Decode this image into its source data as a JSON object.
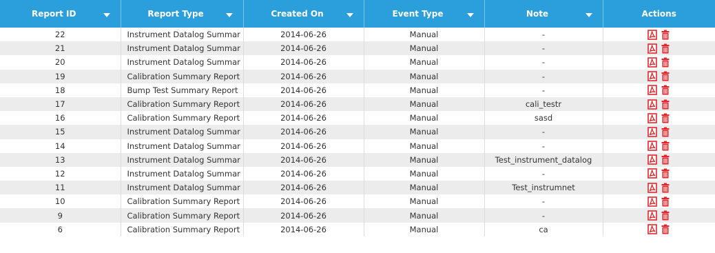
{
  "columns": {
    "report_id": "Report ID",
    "report_type": "Report Type",
    "created_on": "Created On",
    "event_type": "Event Type",
    "note": "Note",
    "actions": "Actions"
  },
  "rows": [
    {
      "id": "22",
      "type": "Instrument Datalog Summar",
      "created": "2014-06-26",
      "event": "Manual",
      "note": "-"
    },
    {
      "id": "21",
      "type": "Instrument Datalog Summar",
      "created": "2014-06-26",
      "event": "Manual",
      "note": "-"
    },
    {
      "id": "20",
      "type": "Instrument Datalog Summar",
      "created": "2014-06-26",
      "event": "Manual",
      "note": "-"
    },
    {
      "id": "19",
      "type": "Calibration Summary Report",
      "created": "2014-06-26",
      "event": "Manual",
      "note": "-"
    },
    {
      "id": "18",
      "type": "Bump Test Summary Report",
      "created": "2014-06-26",
      "event": "Manual",
      "note": "-"
    },
    {
      "id": "17",
      "type": "Calibration Summary Report",
      "created": "2014-06-26",
      "event": "Manual",
      "note": "cali_testr"
    },
    {
      "id": "16",
      "type": "Calibration Summary Report",
      "created": "2014-06-26",
      "event": "Manual",
      "note": "sasd"
    },
    {
      "id": "15",
      "type": "Instrument Datalog Summar",
      "created": "2014-06-26",
      "event": "Manual",
      "note": "-"
    },
    {
      "id": "14",
      "type": "Instrument Datalog Summar",
      "created": "2014-06-26",
      "event": "Manual",
      "note": "-"
    },
    {
      "id": "13",
      "type": "Instrument Datalog Summar",
      "created": "2014-06-26",
      "event": "Manual",
      "note": "Test_instrument_datalog"
    },
    {
      "id": "12",
      "type": "Instrument Datalog Summar",
      "created": "2014-06-26",
      "event": "Manual",
      "note": "-"
    },
    {
      "id": "11",
      "type": "Instrument Datalog Summar",
      "created": "2014-06-26",
      "event": "Manual",
      "note": "Test_instrumnet"
    },
    {
      "id": "10",
      "type": "Calibration Summary Report",
      "created": "2014-06-26",
      "event": "Manual",
      "note": "-"
    },
    {
      "id": "9",
      "type": "Calibration Summary Report",
      "created": "2014-06-26",
      "event": "Manual",
      "note": "-"
    },
    {
      "id": "6",
      "type": "Calibration Summary Report",
      "created": "2014-06-26",
      "event": "Manual",
      "note": "ca"
    }
  ],
  "icons": {
    "pdf": "pdf-icon",
    "delete": "trash-icon"
  },
  "colors": {
    "header_bg": "#2b9fdc",
    "header_text": "#ffffff",
    "row_alt": "#ececec",
    "icon_red": "#e8232a"
  }
}
